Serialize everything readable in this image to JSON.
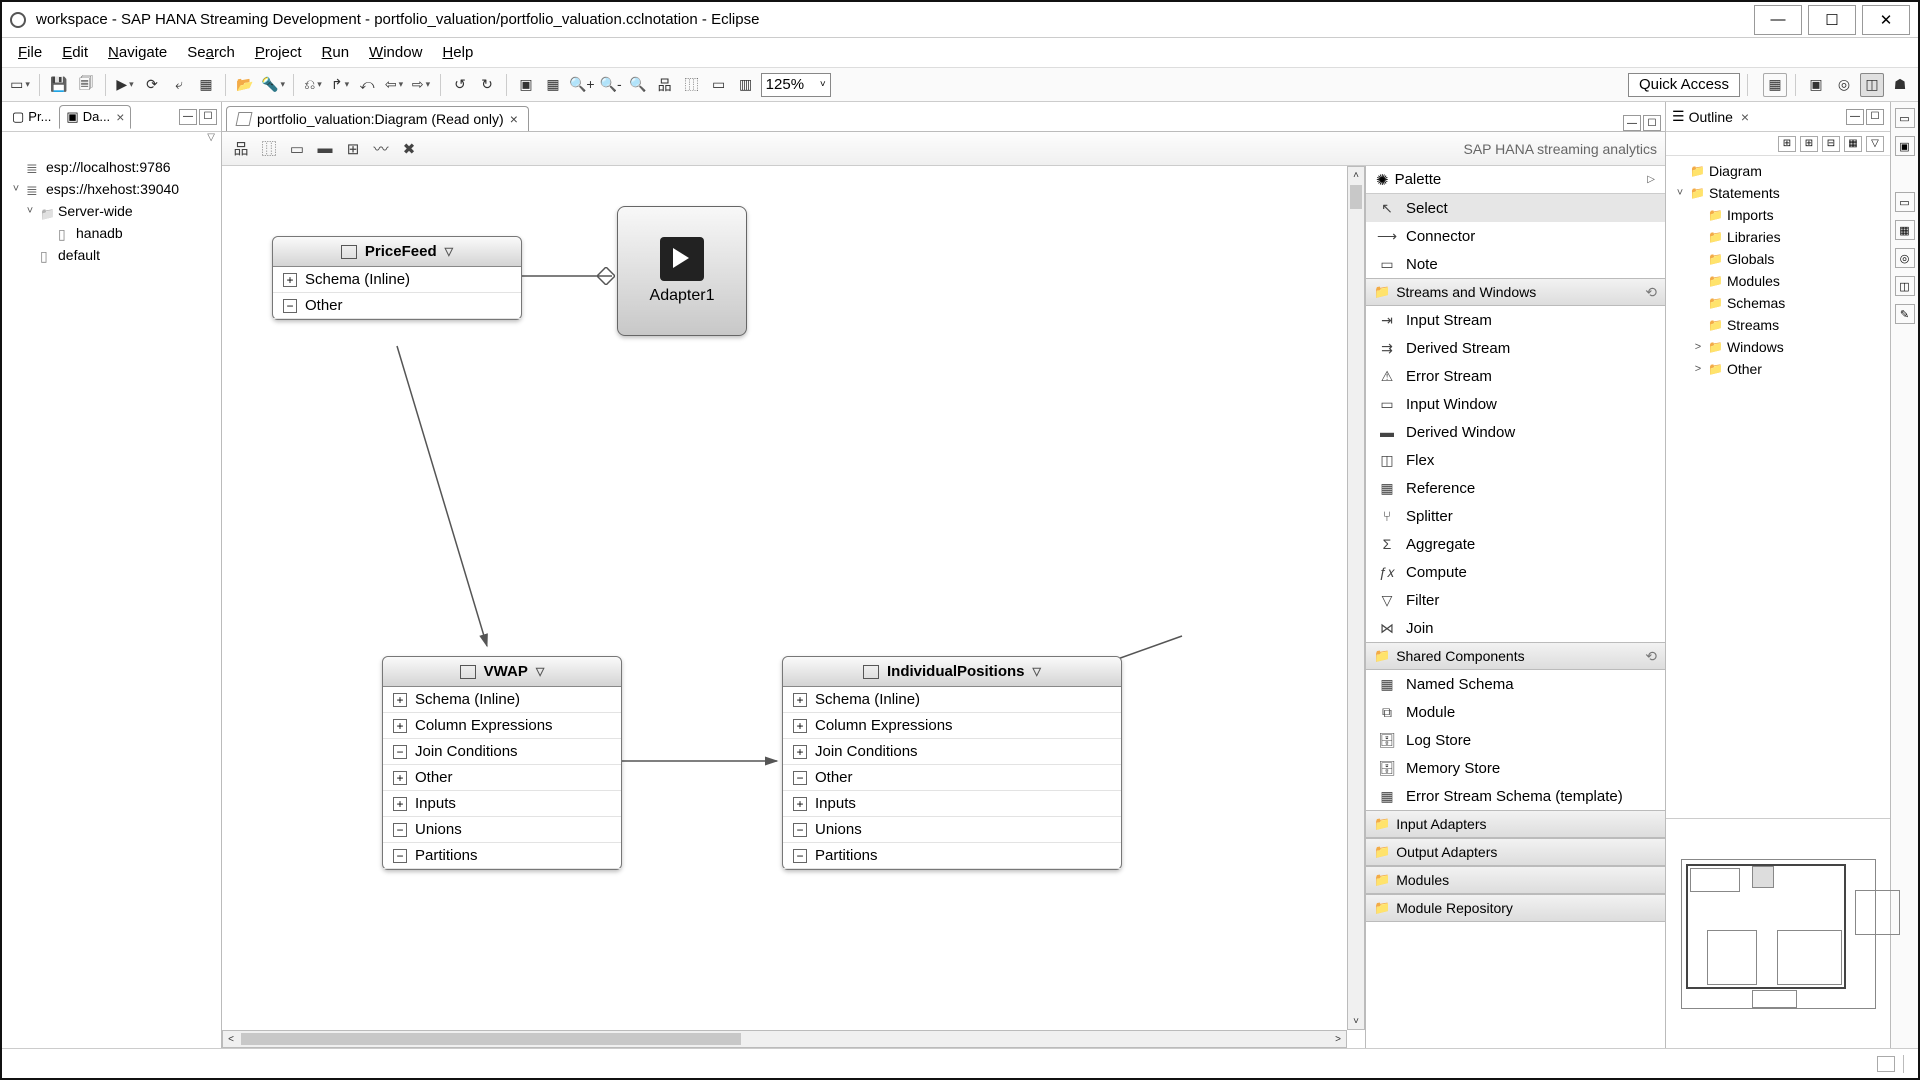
{
  "window": {
    "title": "workspace - SAP HANA Streaming Development - portfolio_valuation/portfolio_valuation.cclnotation - Eclipse"
  },
  "menubar": {
    "items": [
      {
        "u": "F",
        "rest": "ile"
      },
      {
        "u": "E",
        "rest": "dit"
      },
      {
        "u": "N",
        "rest": "avigate"
      },
      {
        "u": "Se",
        "rest": "arch",
        "underline_at": 2
      },
      {
        "u": "P",
        "rest": "roject"
      },
      {
        "u": "R",
        "rest": "un"
      },
      {
        "u": "W",
        "rest": "indow"
      },
      {
        "u": "H",
        "rest": "elp"
      }
    ]
  },
  "toolbar": {
    "zoom": "125%",
    "quick_access": "Quick Access"
  },
  "left_panel": {
    "tabs": [
      {
        "label": "Pr...",
        "active": false
      },
      {
        "label": "Da...",
        "active": true
      }
    ],
    "tree": {
      "root1": "esp://localhost:9786",
      "root2": "esps://hxehost:39040",
      "child1": "Server-wide",
      "child2": "hanadb",
      "child3": "default"
    }
  },
  "editor": {
    "tab_label": "portfolio_valuation:Diagram (Read only)",
    "header_label": "SAP HANA streaming analytics",
    "nodes": {
      "pricefeed": {
        "title": "PriceFeed",
        "items": [
          {
            "op": "+",
            "label": "Schema (Inline)"
          },
          {
            "op": "-",
            "label": "Other"
          }
        ]
      },
      "adapter1": {
        "title": "Adapter1"
      },
      "vwap": {
        "title": "VWAP",
        "items": [
          {
            "op": "+",
            "label": "Schema (Inline)"
          },
          {
            "op": "+",
            "label": "Column Expressions"
          },
          {
            "op": "-",
            "label": "Join Conditions"
          },
          {
            "op": "+",
            "label": "Other"
          },
          {
            "op": "+",
            "label": "Inputs"
          },
          {
            "op": "-",
            "label": "Unions"
          },
          {
            "op": "-",
            "label": "Partitions"
          }
        ]
      },
      "indiv": {
        "title": "IndividualPositions",
        "items": [
          {
            "op": "+",
            "label": "Schema (Inline)"
          },
          {
            "op": "+",
            "label": "Column Expressions"
          },
          {
            "op": "+",
            "label": "Join Conditions"
          },
          {
            "op": "-",
            "label": "Other"
          },
          {
            "op": "+",
            "label": "Inputs"
          },
          {
            "op": "-",
            "label": "Unions"
          },
          {
            "op": "-",
            "label": "Partitions"
          }
        ]
      }
    }
  },
  "palette": {
    "title": "Palette",
    "top": [
      {
        "icon": "cursor",
        "label": "Select",
        "selected": true
      },
      {
        "icon": "conn",
        "label": "Connector"
      },
      {
        "icon": "note",
        "label": "Note"
      }
    ],
    "streams_hdr": "Streams and Windows",
    "streams": [
      {
        "icon": "istr",
        "label": "Input Stream"
      },
      {
        "icon": "dstr",
        "label": "Derived Stream"
      },
      {
        "icon": "estr",
        "label": "Error Stream"
      },
      {
        "icon": "iwin",
        "label": "Input Window"
      },
      {
        "icon": "dwin",
        "label": "Derived Window"
      },
      {
        "icon": "flex",
        "label": "Flex"
      },
      {
        "icon": "ref",
        "label": "Reference"
      },
      {
        "icon": "spl",
        "label": "Splitter"
      },
      {
        "icon": "agg",
        "label": "Aggregate"
      },
      {
        "icon": "cmp",
        "label": "Compute"
      },
      {
        "icon": "flt",
        "label": "Filter"
      },
      {
        "icon": "jn",
        "label": "Join"
      }
    ],
    "shared_hdr": "Shared Components",
    "shared": [
      {
        "icon": "sch",
        "label": "Named Schema"
      },
      {
        "icon": "mod",
        "label": "Module"
      },
      {
        "icon": "log",
        "label": "Log Store"
      },
      {
        "icon": "mem",
        "label": "Memory Store"
      },
      {
        "icon": "errt",
        "label": "Error Stream Schema (template)"
      }
    ],
    "bottom_sections": [
      "Input Adapters",
      "Output Adapters",
      "Modules",
      "Module Repository"
    ]
  },
  "outline": {
    "title": "Outline",
    "tree": [
      {
        "depth": 0,
        "exp": "",
        "label": "Diagram"
      },
      {
        "depth": 0,
        "exp": "v",
        "label": "Statements"
      },
      {
        "depth": 1,
        "exp": "",
        "label": "Imports"
      },
      {
        "depth": 1,
        "exp": "",
        "label": "Libraries"
      },
      {
        "depth": 1,
        "exp": "",
        "label": "Globals"
      },
      {
        "depth": 1,
        "exp": "",
        "label": "Modules"
      },
      {
        "depth": 1,
        "exp": "",
        "label": "Schemas"
      },
      {
        "depth": 1,
        "exp": "",
        "label": "Streams"
      },
      {
        "depth": 1,
        "exp": ">",
        "label": "Windows"
      },
      {
        "depth": 1,
        "exp": ">",
        "label": "Other"
      }
    ]
  }
}
